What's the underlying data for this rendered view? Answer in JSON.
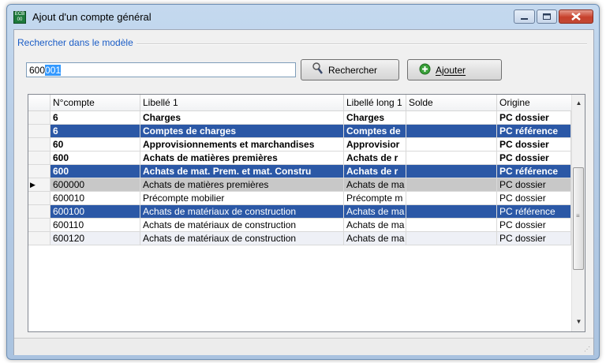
{
  "window": {
    "title": "Ajout d'un compte général",
    "app_icon_text": "ECB 00"
  },
  "search_group": {
    "label": "Rechercher dans le modèle"
  },
  "search": {
    "value_plain": "600",
    "value_selected": "001"
  },
  "buttons": {
    "search_label": "Rechercher",
    "add_label": "Ajouter"
  },
  "table": {
    "columns": [
      "N°compte",
      "Libellé 1",
      "Libellé long 1",
      "Solde",
      "Origine"
    ],
    "rows": [
      {
        "compte": "6",
        "libelle": "Charges",
        "libelle_long": "Charges",
        "solde": "",
        "origine": "PC dossier",
        "style": "bold"
      },
      {
        "compte": "6",
        "libelle": "Comptes de charges",
        "libelle_long": "Comptes de",
        "solde": "",
        "origine": "PC référence",
        "style": "bold-selected"
      },
      {
        "compte": "60",
        "libelle": "Approvisionnements et marchandises",
        "libelle_long": "Approvisior",
        "solde": "",
        "origine": "PC dossier",
        "style": "bold"
      },
      {
        "compte": "600",
        "libelle": "Achats de matières premières",
        "libelle_long": "Achats de r",
        "solde": "",
        "origine": "PC dossier",
        "style": "bold"
      },
      {
        "compte": "600",
        "libelle": "Achats de mat. Prem. et mat. Constru",
        "libelle_long": "Achats de r",
        "solde": "",
        "origine": "PC référence",
        "style": "bold-selected"
      },
      {
        "compte": "600000",
        "libelle": "Achats de matières premières",
        "libelle_long": "Achats de ma",
        "solde": "",
        "origine": "PC dossier",
        "style": "current"
      },
      {
        "compte": "600010",
        "libelle": "Précompte mobilier",
        "libelle_long": "Précompte m",
        "solde": "",
        "origine": "PC dossier",
        "style": "normal"
      },
      {
        "compte": "600100",
        "libelle": "Achats de matériaux de construction",
        "libelle_long": "Achats de ma",
        "solde": "",
        "origine": "PC référence",
        "style": "selected"
      },
      {
        "compte": "600110",
        "libelle": "Achats de matériaux de construction",
        "libelle_long": "Achats de ma",
        "solde": "",
        "origine": "PC dossier",
        "style": "normal"
      },
      {
        "compte": "600120",
        "libelle": "Achats de matériaux de construction",
        "libelle_long": "Achats de ma",
        "solde": "",
        "origine": "PC dossier",
        "style": "alt"
      }
    ]
  },
  "icons": {
    "search": "magnifier-icon",
    "add": "green-plus-circle-icon",
    "row_indicator": "triangle-right-icon"
  },
  "colors": {
    "selection": "#2b58a6",
    "current_row": "#c8c8c8",
    "group_label": "#1b5dc6",
    "close_button": "#c7402b"
  }
}
